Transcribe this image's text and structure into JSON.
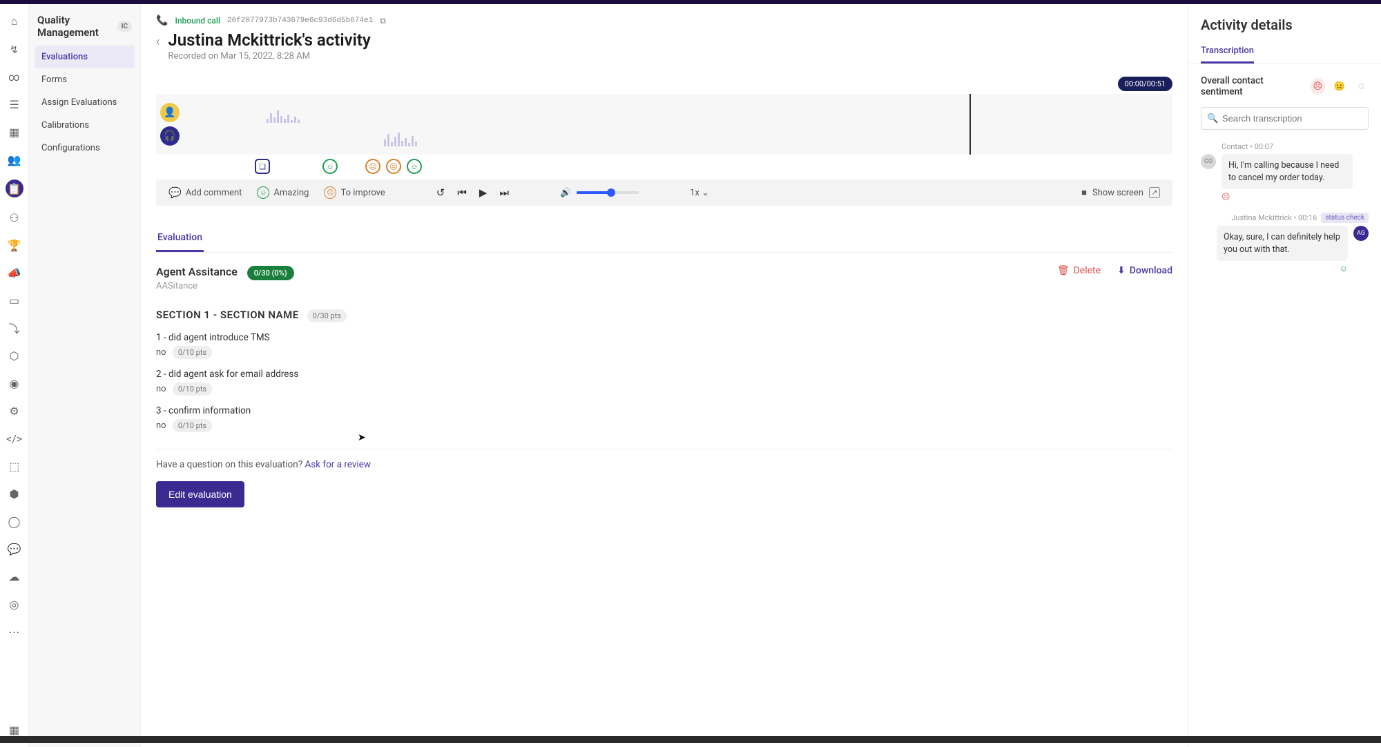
{
  "module": {
    "title": "Quality Management",
    "badge": "IC"
  },
  "sidenav": {
    "items": [
      {
        "label": "Evaluations",
        "active": true
      },
      {
        "label": "Forms"
      },
      {
        "label": "Assign Evaluations"
      },
      {
        "label": "Calibrations"
      },
      {
        "label": "Configurations"
      }
    ]
  },
  "call": {
    "direction_label": "Inbound call",
    "call_id": "20f2077973b743679e6c93d6d5b674e1",
    "title": "Justina Mckittrick's activity",
    "recorded": "Recorded on Mar 15, 2022, 8:28 AM"
  },
  "player": {
    "time": "00:00/00:51",
    "add_comment": "Add comment",
    "amazing": "Amazing",
    "to_improve": "To improve",
    "speed": "1x",
    "show_screen": "Show screen"
  },
  "tabs": {
    "evaluation": "Evaluation"
  },
  "evaluation": {
    "name": "Agent Assitance",
    "score": "0/30 (0%)",
    "sub": "AASitance",
    "delete": "Delete",
    "download": "Download",
    "section_title": "SECTION 1 - SECTION NAME",
    "section_pts": "0/30 pts",
    "q1": "1 - did agent introduce TMS",
    "a1": "no",
    "p1": "0/10 pts",
    "q2": "2 - did agent ask for email address",
    "a2": "no",
    "p2": "0/10 pts",
    "q3": "3 - confirm information",
    "a3": "no",
    "p3": "0/10 pts",
    "review_q": "Have a question on this evaluation? ",
    "review_link": "Ask for a review",
    "edit_btn": "Edit evaluation"
  },
  "details": {
    "title": "Activity details",
    "tab": "Transcription",
    "sentiment_label": "Overall contact sentiment",
    "search_placeholder": "Search transcription",
    "msg1_meta": "Contact • 00:07",
    "msg1_text": "Hi, I'm calling because I need to cancel my order today.",
    "msg2_meta": "Justina Mckittrick • 00:16",
    "msg2_tag": "status check",
    "msg2_text": "Okay, sure, I can definitely help you out with that."
  }
}
